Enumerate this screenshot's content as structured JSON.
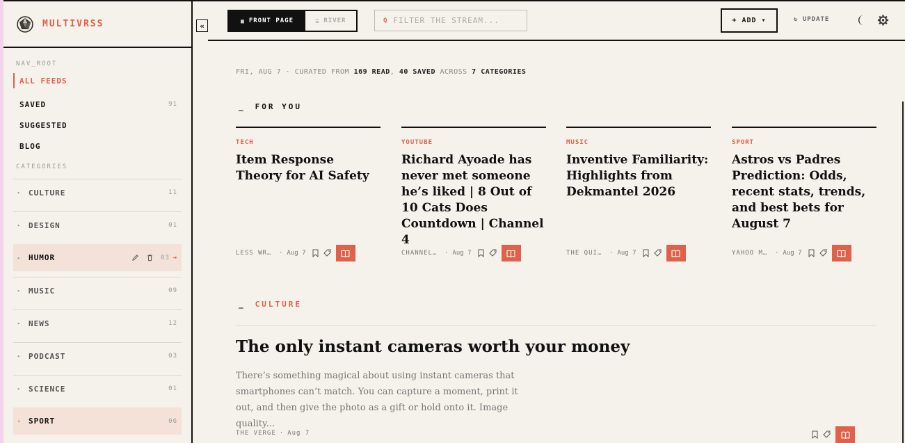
{
  "brand": {
    "name": "MULTIVRSS"
  },
  "sidebar": {
    "nav_root_label": "NAV_ROOT",
    "items": [
      {
        "label": "ALL FEEDS",
        "count": ""
      },
      {
        "label": "SAVED",
        "count": "91"
      },
      {
        "label": "SUGGESTED",
        "count": ""
      },
      {
        "label": "BLOG",
        "count": ""
      }
    ],
    "categories_label": "CATEGORIES",
    "categories": [
      {
        "label": "CULTURE",
        "count": "11"
      },
      {
        "label": "DESIGN",
        "count": "01"
      },
      {
        "label": "HUMOR",
        "count": "03"
      },
      {
        "label": "MUSIC",
        "count": "09"
      },
      {
        "label": "NEWS",
        "count": "12"
      },
      {
        "label": "PODCAST",
        "count": "03"
      },
      {
        "label": "SCIENCE",
        "count": "01"
      },
      {
        "label": "SPORT",
        "count": "06"
      }
    ]
  },
  "toolbar": {
    "collapse": "«",
    "front_page": "FRONT PAGE",
    "river": "RIVER",
    "filter_placeholder": "FILTER THE STREAM...",
    "filter_q": "Q",
    "add": "+ ADD ▾",
    "update": "↻ UPDATE"
  },
  "meta": {
    "date": "FRI, AUG 7",
    "curated_from": "· CURATED FROM",
    "read": "169 READ",
    "comma": ",",
    "saved": "40 SAVED",
    "across": "ACROSS",
    "categories": "7 CATEGORIES"
  },
  "for_you": {
    "heading": "FOR YOU",
    "cards": [
      {
        "category": "TECH",
        "title": "Item Response Theory for AI Safety",
        "source": "LESS WR…",
        "date": "Aug 7"
      },
      {
        "category": "YOUTUBE",
        "title": "Richard Ayoade has never met someone he’s liked | 8 Out of 10 Cats Does Countdown | Channel 4",
        "source": "CHANNEL…",
        "date": "Aug 7"
      },
      {
        "category": "MUSIC",
        "title": "Inventive Familiarity: Highlights from Dekmantel 2026",
        "source": "THE QUI…",
        "date": "Aug 7"
      },
      {
        "category": "SPORT",
        "title": "Astros vs Padres Prediction: Odds, recent stats, trends, and best bets for August 7",
        "source": "YAHOO M…",
        "date": "Aug 7"
      }
    ]
  },
  "culture": {
    "heading": "CULTURE",
    "title": "The only instant cameras worth your money",
    "excerpt": "There’s something magical about using instant cameras that smartphones can’t match. You can capture a moment, print it out, and then give the photo as a gift or hold onto it. Image quality...",
    "source": "THE VERGE",
    "date": "Aug 7"
  },
  "colors": {
    "accent": "#e0614a",
    "background": "#f5f1eb",
    "ink": "#111111",
    "highlight": "#f4e2d9"
  }
}
